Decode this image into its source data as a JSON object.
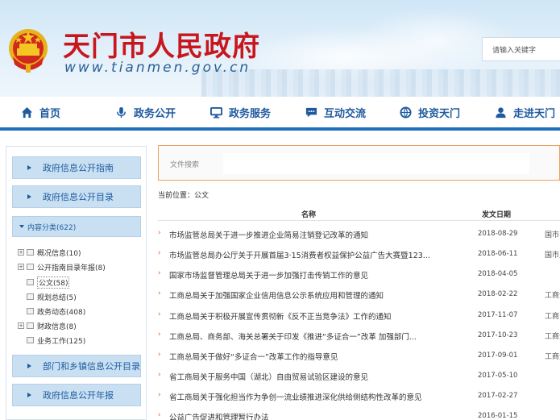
{
  "header": {
    "title": "天门市人民政府",
    "url_text": "www.tianmen.gov.cn",
    "search_placeholder": "请输入关键字"
  },
  "nav": {
    "items": [
      {
        "label": "首页",
        "icon": "home-icon"
      },
      {
        "label": "政务公开",
        "icon": "microphone-icon"
      },
      {
        "label": "政务服务",
        "icon": "monitor-icon"
      },
      {
        "label": "互动交流",
        "icon": "chat-icon"
      },
      {
        "label": "投资天门",
        "icon": "globe-icon"
      },
      {
        "label": "走进天门",
        "icon": "person-icon"
      }
    ]
  },
  "sidebar": {
    "buttons": [
      {
        "label": "政府信息公开指南"
      },
      {
        "label": "政府信息公开目录"
      },
      {
        "label": "部门和乡镇信息公开目录"
      },
      {
        "label": "政府信息公开年报"
      }
    ],
    "tree_header": "内容分类(622)",
    "tree": [
      {
        "label": "概况信息(10)",
        "expandable": true
      },
      {
        "label": "公开指南目录年报(8)",
        "expandable": true
      },
      {
        "label": "公文(58)",
        "expandable": false
      },
      {
        "label": "规划总结(5)",
        "expandable": false
      },
      {
        "label": "政务动态(408)",
        "expandable": false
      },
      {
        "label": "财政信息(8)",
        "expandable": true
      },
      {
        "label": "业务工作(125)",
        "expandable": false
      }
    ]
  },
  "main": {
    "file_search_label": "文件搜索",
    "breadcrumb": "当前位置：公文",
    "columns": {
      "name": "名称",
      "date": "发文日期"
    },
    "rows": [
      {
        "title": "市场监管总局关于进一步推进企业简易注销登记改革的通知",
        "date": "2018-08-29",
        "dept": "国市"
      },
      {
        "title": "市场监管总局办公厅关于开展首届3·15消费者权益保护公益广告大赛暨123...",
        "date": "2018-06-11",
        "dept": "国市监"
      },
      {
        "title": "国家市场监督管理总局关于进一步加强打击传销工作的意见",
        "date": "2018-04-05",
        "dept": ""
      },
      {
        "title": "工商总局关于加强国家企业信用信息公示系统应用和管理的通知",
        "date": "2018-02-22",
        "dept": "工商企"
      },
      {
        "title": "工商总局关于积极开展宣传贯彻新《反不正当竞争法》工作的通知",
        "date": "2017-11-07",
        "dept": "工商"
      },
      {
        "title": "工商总局、商务部、海关总署关于印发《推进“多证合一”改革 加强部门...",
        "date": "2017-10-23",
        "dept": "工商企"
      },
      {
        "title": "工商总局关于做好“多证合一”改革工作的指导意见",
        "date": "2017-09-01",
        "dept": "工商企"
      },
      {
        "title": "省工商局关于服务中国（湖北）自由贸易试验区建设的意见",
        "date": "2017-05-10",
        "dept": ""
      },
      {
        "title": "省工商局关于强化担当作为争创一流业绩推进深化供给侧结构性改革的意见",
        "date": "2017-02-27",
        "dept": ""
      },
      {
        "title": "公益广告促进和管理暂行办法",
        "date": "2016-01-15",
        "dept": ""
      }
    ]
  }
}
